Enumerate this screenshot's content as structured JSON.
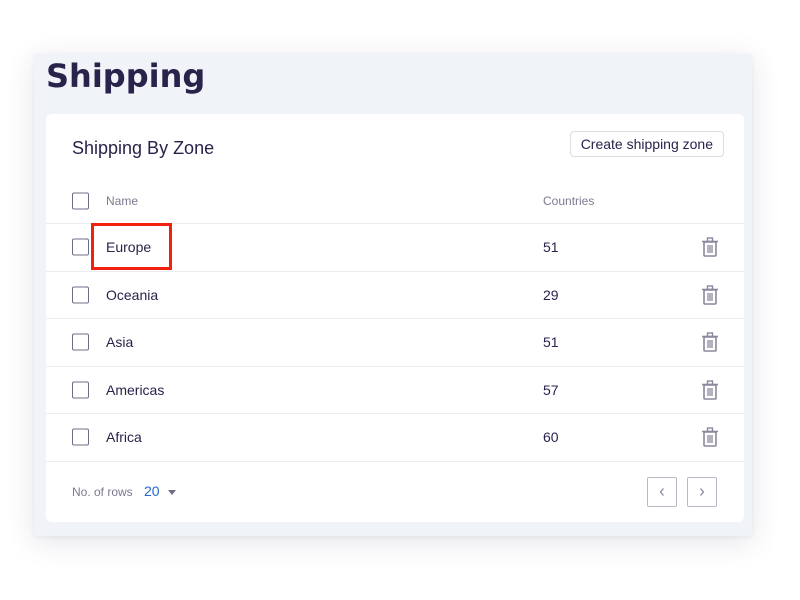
{
  "page": {
    "title": "Shipping"
  },
  "card": {
    "title": "Shipping By Zone",
    "create_button": "Create shipping zone"
  },
  "table": {
    "columns": {
      "name": "Name",
      "countries": "Countries"
    },
    "rows": [
      {
        "name": "Europe",
        "countries": "51",
        "highlighted": true
      },
      {
        "name": "Oceania",
        "countries": "29"
      },
      {
        "name": "Asia",
        "countries": "51"
      },
      {
        "name": "Americas",
        "countries": "57"
      },
      {
        "name": "Africa",
        "countries": "60"
      }
    ]
  },
  "footer": {
    "rows_label": "No. of rows",
    "rows_value": "20"
  },
  "icons": {
    "row_action": "trash-icon",
    "rows_dropdown": "caret-down-icon",
    "prev_page": "chevron-left-icon",
    "next_page": "chevron-right-icon"
  },
  "colors": {
    "accent": "#2366d1",
    "highlight": "#f0210d",
    "title": "#28234a",
    "background": "#f0f4f8"
  }
}
